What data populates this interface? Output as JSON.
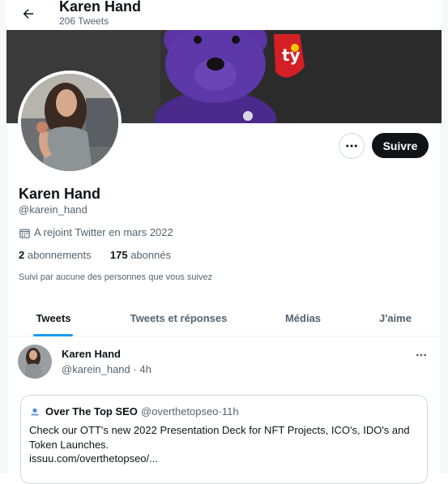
{
  "header": {
    "name": "Karen Hand",
    "tweet_count": "206 Tweets"
  },
  "profile": {
    "name": "Karen Hand",
    "handle": "@karein_hand",
    "joined": "A rejoint Twitter en mars 2022",
    "following_count": "2",
    "following_label": "abonnements",
    "followers_count": "175",
    "followers_label": "abonnés",
    "followed_by": "Suivi par aucune des personnes que vous suivez"
  },
  "actions": {
    "follow_label": "Suivre"
  },
  "tabs": [
    {
      "label": "Tweets",
      "active": true
    },
    {
      "label": "Tweets et réponses",
      "active": false
    },
    {
      "label": "Médias",
      "active": false
    },
    {
      "label": "J'aime",
      "active": false
    }
  ],
  "tweet": {
    "author_name": "Karen Hand",
    "author_handle": "@karein_hand",
    "time": "4h",
    "quote": {
      "author_name": "Over The Top SEO",
      "author_handle": "@overthetopseo",
      "time": "11h",
      "text": "Check our OTT's new 2022 Presentation Deck for NFT Projects, ICO's, IDO's and Token Launches.",
      "link": "issuu.com/overthetopseo/..."
    }
  },
  "colors": {
    "accent": "#1d9bf0",
    "text": "#0f1419",
    "muted": "#536471",
    "button_dark": "#0f1419",
    "border": "#cfd9de"
  },
  "icons": {
    "back": "arrow-left-icon",
    "calendar": "calendar-icon",
    "more": "more-horizontal-icon"
  }
}
